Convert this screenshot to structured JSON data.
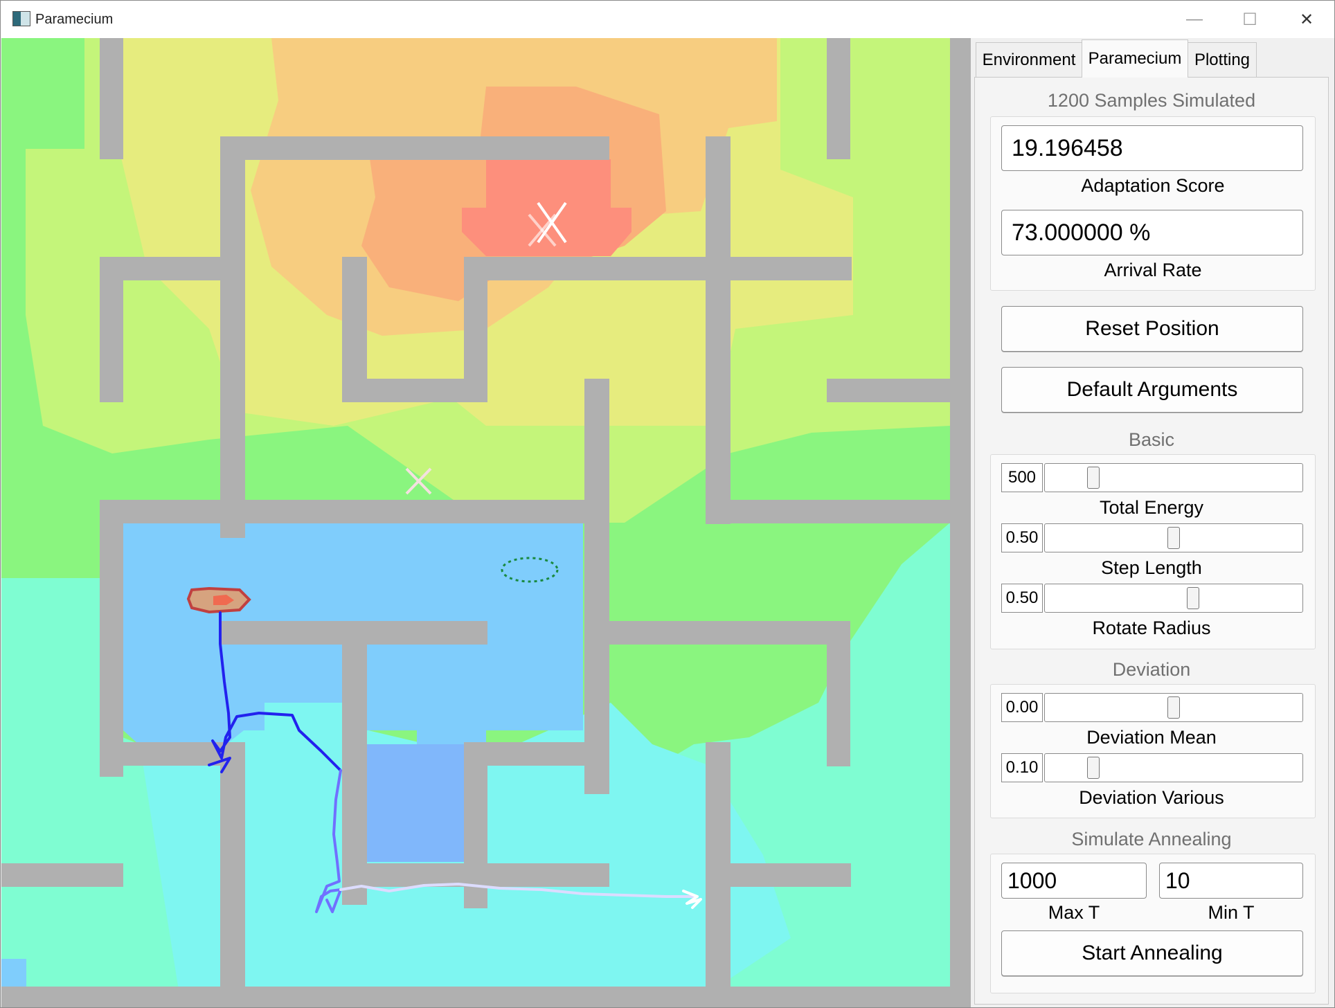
{
  "window": {
    "title": "Paramecium",
    "controls": [
      "—",
      "☐",
      "✕"
    ]
  },
  "tabs": [
    {
      "label": "Environment",
      "active": false
    },
    {
      "label": "Paramecium",
      "active": true
    },
    {
      "label": "Plotting",
      "active": false
    }
  ],
  "status": {
    "samples_heading": "1200 Samples Simulated",
    "adaptation_score": "19.196458",
    "adaptation_label": "Adaptation Score",
    "arrival_rate": "73.000000 %",
    "arrival_label": "Arrival Rate"
  },
  "buttons": {
    "reset": "Reset Position",
    "defaults": "Default Arguments",
    "anneal": "Start Annealing"
  },
  "basic": {
    "heading": "Basic",
    "sliders": [
      {
        "label": "Total Energy",
        "value": "500",
        "fraction": 0.17
      },
      {
        "label": "Step Length",
        "value": "0.50",
        "fraction": 0.5
      },
      {
        "label": "Rotate Radius",
        "value": "0.50",
        "fraction": 0.58
      }
    ]
  },
  "deviation": {
    "heading": "Deviation",
    "sliders": [
      {
        "label": "Deviation Mean",
        "value": "0.00",
        "fraction": 0.5
      },
      {
        "label": "Deviation Various",
        "value": "0.10",
        "fraction": 0.17
      }
    ]
  },
  "annealing": {
    "heading": "Simulate Annealing",
    "max_t": "1000",
    "max_t_label": "Max T",
    "min_t": "10",
    "min_t_label": "Min T"
  },
  "colors": {
    "wall": "#b0b0b0",
    "green": "#8af57f",
    "light_green": "#c4f57a",
    "yellow": "#e6ec7e",
    "orange": "#f7cd80",
    "peach": "#f9b07a",
    "red": "#fd8f7c",
    "cyan": "#7ef6f1",
    "aqua": "#7ffdd2",
    "sky": "#7fcdfc",
    "blue": "#80b7fb",
    "path_dark": "#2222ee",
    "path_mid": "#8080ff",
    "path_light": "#d8d8ff"
  }
}
